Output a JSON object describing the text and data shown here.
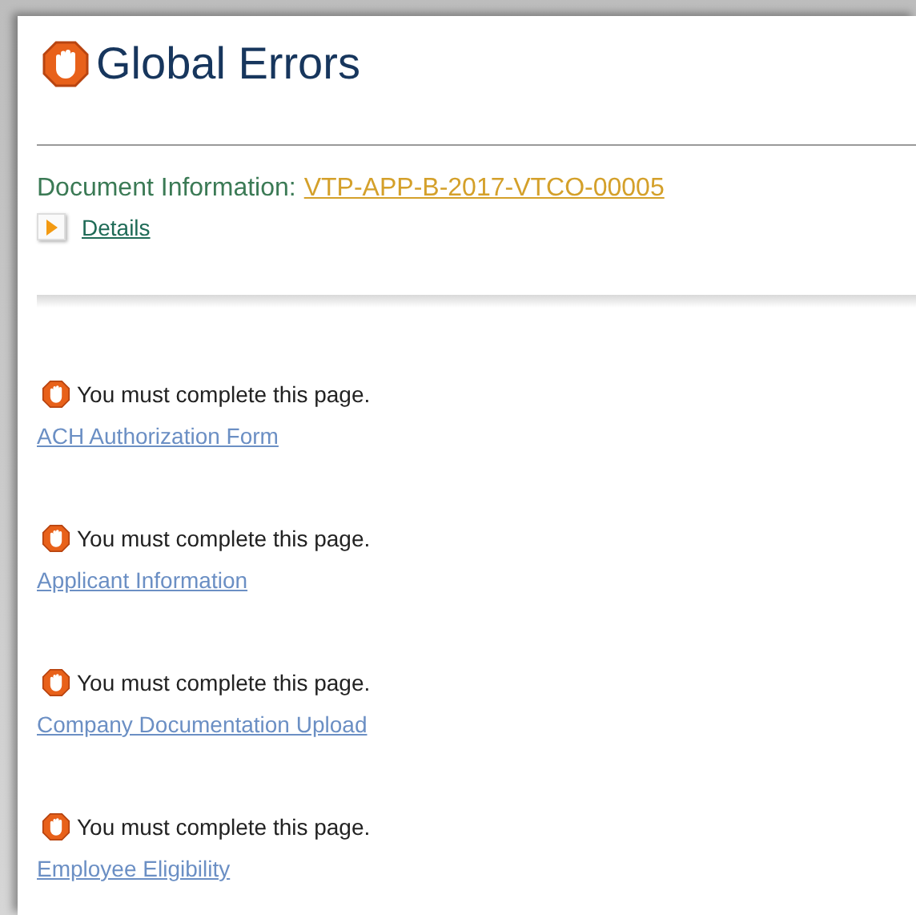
{
  "title": "Global Errors",
  "document": {
    "label": "Document Information:",
    "link": "VTP-APP-B-2017-VTCO-00005"
  },
  "details": {
    "label": "Details",
    "expanded": false
  },
  "errors": [
    {
      "message": "You must complete this page.",
      "page": "ACH Authorization Form"
    },
    {
      "message": "You must complete this page.",
      "page": "Applicant Information"
    },
    {
      "message": "You must complete this page.",
      "page": "Company Documentation Upload"
    },
    {
      "message": "You must complete this page.",
      "page": "Employee Eligibility"
    }
  ]
}
